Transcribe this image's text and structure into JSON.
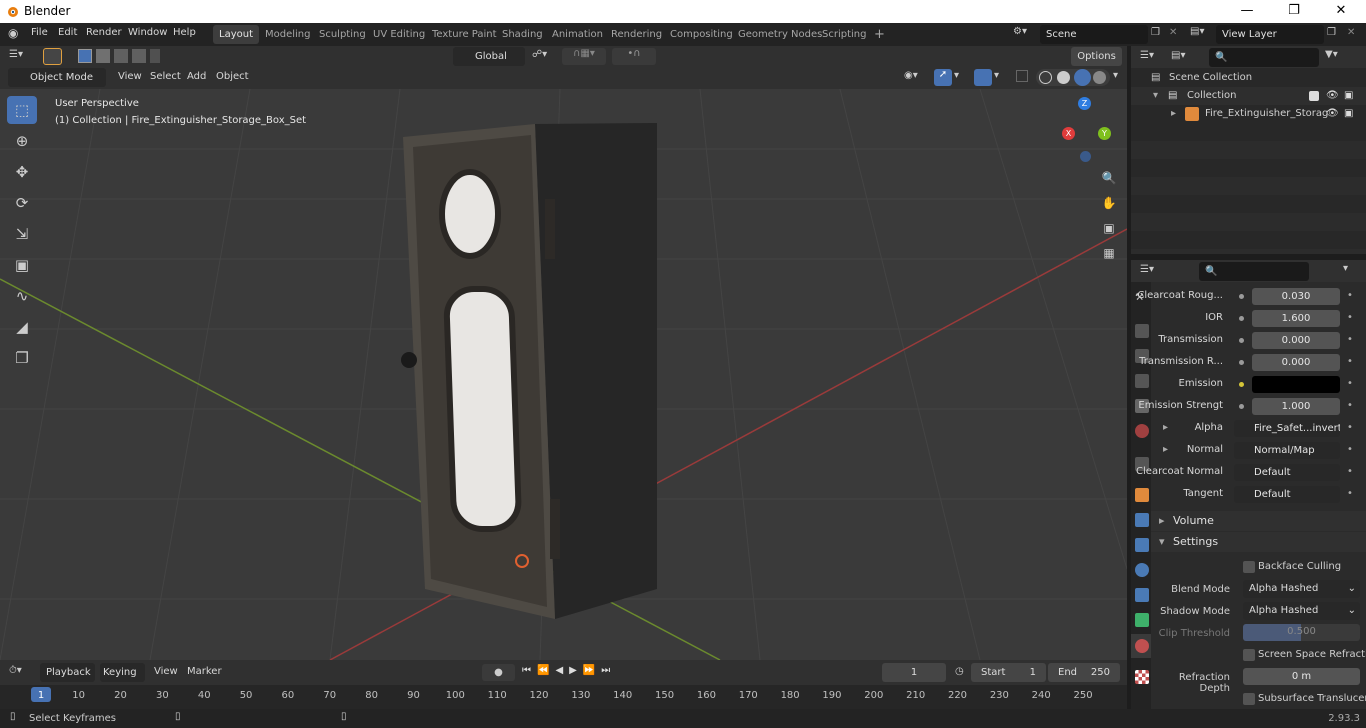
{
  "app": {
    "title": "Blender",
    "version": "2.93.3"
  },
  "menus": [
    "File",
    "Edit",
    "Render",
    "Window",
    "Help"
  ],
  "workspaces": [
    "Layout",
    "Modeling",
    "Sculpting",
    "UV Editing",
    "Texture Paint",
    "Shading",
    "Animation",
    "Rendering",
    "Compositing",
    "Geometry Nodes",
    "Scripting"
  ],
  "active_workspace": "Layout",
  "scene": {
    "name": "Scene",
    "view_layer": "View Layer"
  },
  "viewport": {
    "mode": "Object Mode",
    "menu": [
      "View",
      "Select",
      "Add",
      "Object"
    ],
    "orientation": "Global",
    "options": "Options",
    "overlay_title": "User Perspective",
    "overlay_sub": "(1) Collection | Fire_Extinguisher_Storage_Box_Set",
    "gizmo": {
      "x": "X",
      "y": "Y",
      "z": "Z"
    }
  },
  "outliner": {
    "root": "Scene Collection",
    "collection": "Collection",
    "object": "Fire_Extinguisher_Storag"
  },
  "properties": {
    "rows": [
      {
        "label": "Clearcoat Roug...",
        "value": "0.030",
        "kind": "num"
      },
      {
        "label": "IOR",
        "value": "1.600",
        "kind": "num"
      },
      {
        "label": "Transmission",
        "value": "0.000",
        "kind": "num"
      },
      {
        "label": "Transmission R...",
        "value": "0.000",
        "kind": "num"
      },
      {
        "label": "Emission",
        "value": "",
        "kind": "color"
      },
      {
        "label": "Emission Strengt",
        "value": "1.000",
        "kind": "num"
      },
      {
        "label": "Alpha",
        "value": "Fire_Safet...invert.png",
        "kind": "link"
      },
      {
        "label": "Normal",
        "value": "Normal/Map",
        "kind": "link"
      },
      {
        "label": "Clearcoat Normal",
        "value": "Default",
        "kind": "link"
      },
      {
        "label": "Tangent",
        "value": "Default",
        "kind": "link"
      }
    ],
    "volume": "Volume",
    "settings": "Settings",
    "backface": "Backface Culling",
    "blend_label": "Blend Mode",
    "blend_value": "Alpha Hashed",
    "shadow_label": "Shadow Mode",
    "shadow_value": "Alpha Hashed",
    "clip_label": "Clip Threshold",
    "clip_value": "0.500",
    "ssr": "Screen Space Refraction",
    "refr_label": "Refraction Depth",
    "refr_value": "0 m",
    "sss": "Subsurface Translucency"
  },
  "timeline": {
    "menu": [
      "Playback",
      "Keying",
      "View",
      "Marker"
    ],
    "current": "1",
    "start_label": "Start",
    "start": "1",
    "end_label": "End",
    "end": "250",
    "ticks": [
      "1",
      "10",
      "20",
      "30",
      "40",
      "50",
      "60",
      "70",
      "80",
      "90",
      "100",
      "110",
      "120",
      "130",
      "140",
      "150",
      "160",
      "170",
      "180",
      "190",
      "200",
      "210",
      "220",
      "230",
      "240",
      "250"
    ]
  },
  "status": {
    "left": "Select Keyframes"
  }
}
